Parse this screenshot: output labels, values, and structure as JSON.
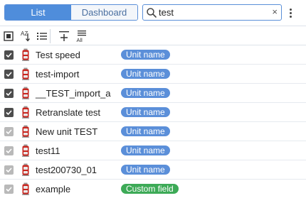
{
  "view_toggle": {
    "list_label": "List",
    "dashboard_label": "Dashboard",
    "active": "List"
  },
  "search": {
    "value": "test",
    "placeholder": "",
    "clear_label": "×"
  },
  "toolbar": {
    "icons": [
      "select-all-icon",
      "sort-az-icon",
      "list-options-icon",
      "add-item-icon",
      "show-all-icon"
    ],
    "sort_az_label": "AZ",
    "show_all_label": "All"
  },
  "colors": {
    "accent": "#4f8ddb",
    "badge_unit": "#5b8fd9",
    "badge_custom": "#3daa57"
  },
  "units": [
    {
      "name": "Test speed",
      "badge": "Unit name",
      "badge_type": "unit",
      "checked": true
    },
    {
      "name": "test-import",
      "badge": "Unit name",
      "badge_type": "unit",
      "checked": true
    },
    {
      "name": "__TEST_import_a",
      "badge": "Unit name",
      "badge_type": "unit",
      "checked": true
    },
    {
      "name": "Retranslate test",
      "badge": "Unit name",
      "badge_type": "unit",
      "checked": true
    },
    {
      "name": "New unit TEST",
      "badge": "Unit name",
      "badge_type": "unit",
      "checked": false
    },
    {
      "name": "test11",
      "badge": "Unit name",
      "badge_type": "unit",
      "checked": false
    },
    {
      "name": "test200730_01",
      "badge": "Unit name",
      "badge_type": "unit",
      "checked": false
    },
    {
      "name": "example",
      "badge": "Custom field",
      "badge_type": "custom",
      "checked": false
    }
  ]
}
